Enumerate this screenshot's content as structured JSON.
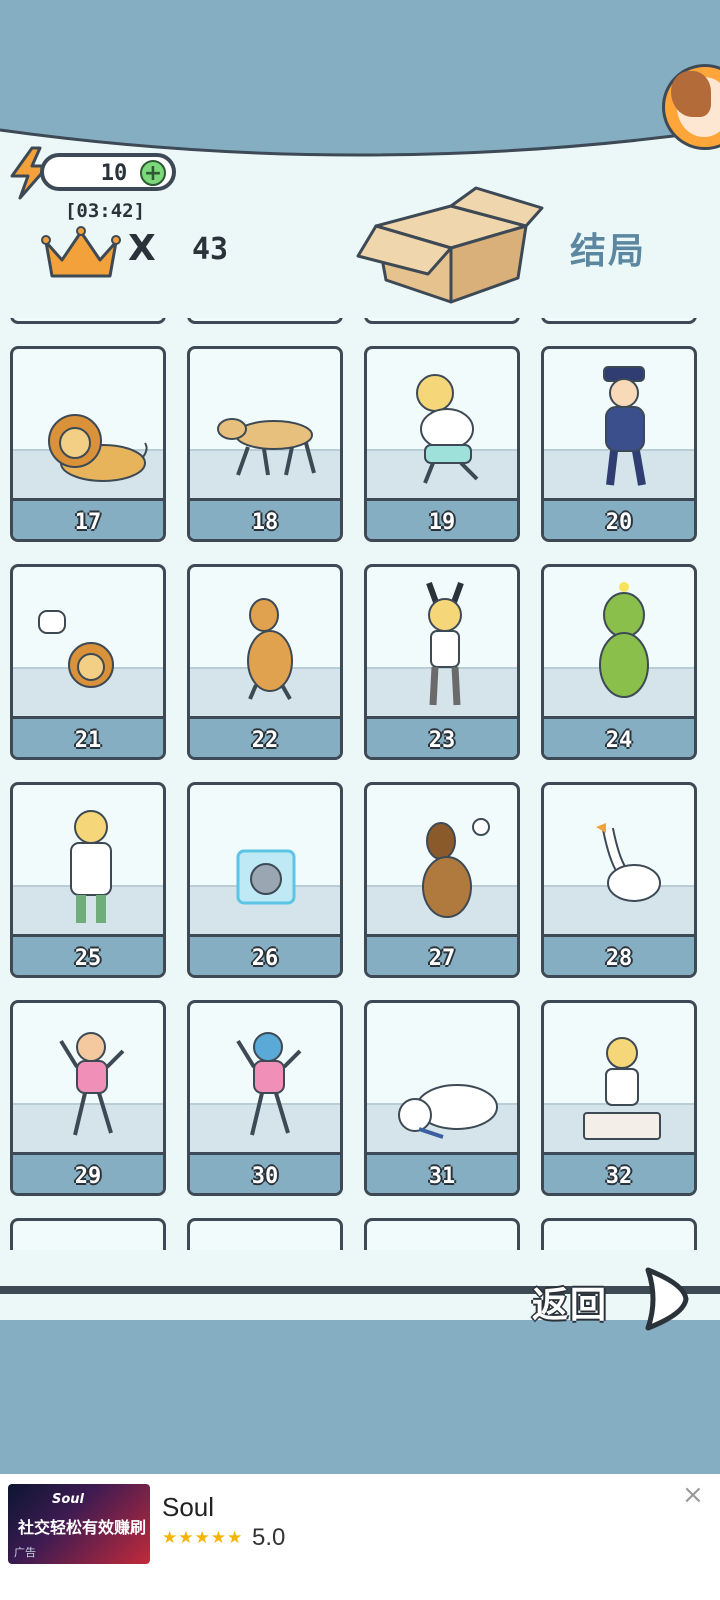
{
  "header": {
    "energy_value": "10",
    "energy_plus": "+",
    "timer": "[03:42]",
    "crown_multiplier": "X",
    "crown_count": "43",
    "ending_title": "结局"
  },
  "cards": [
    {
      "number": "17",
      "subject": "lion"
    },
    {
      "number": "18",
      "subject": "dog-walking"
    },
    {
      "number": "19",
      "subject": "boy-crying"
    },
    {
      "number": "20",
      "subject": "police-officer"
    },
    {
      "number": "21",
      "subject": "small-lion-confused"
    },
    {
      "number": "22",
      "subject": "golden-retriever-sitting"
    },
    {
      "number": "23",
      "subject": "boy-bunny-costume"
    },
    {
      "number": "24",
      "subject": "green-costume-boy"
    },
    {
      "number": "25",
      "subject": "doctor-boy"
    },
    {
      "number": "26",
      "subject": "cat-in-ice-cube"
    },
    {
      "number": "27",
      "subject": "german-shepherd"
    },
    {
      "number": "28",
      "subject": "goose"
    },
    {
      "number": "29",
      "subject": "girl-dancing"
    },
    {
      "number": "30",
      "subject": "girl-blue-hair-dancing"
    },
    {
      "number": "31",
      "subject": "polar-bear"
    },
    {
      "number": "32",
      "subject": "boy-in-box"
    }
  ],
  "footer": {
    "back_label": "返回"
  },
  "ad": {
    "thumb_title": "Soul",
    "thumb_tagline": "社交轻松有效赚刷",
    "thumb_tag": "广告",
    "app_name": "Soul",
    "stars": "★★★★★",
    "rating": "5.0",
    "close": "×"
  },
  "colors": {
    "background": "#86aec3",
    "panel": "#ecf8f8",
    "outline": "#3d4a55",
    "card_label": "#86aec3",
    "ending_title": "#5b88a0",
    "crown": "#f3a23b"
  }
}
